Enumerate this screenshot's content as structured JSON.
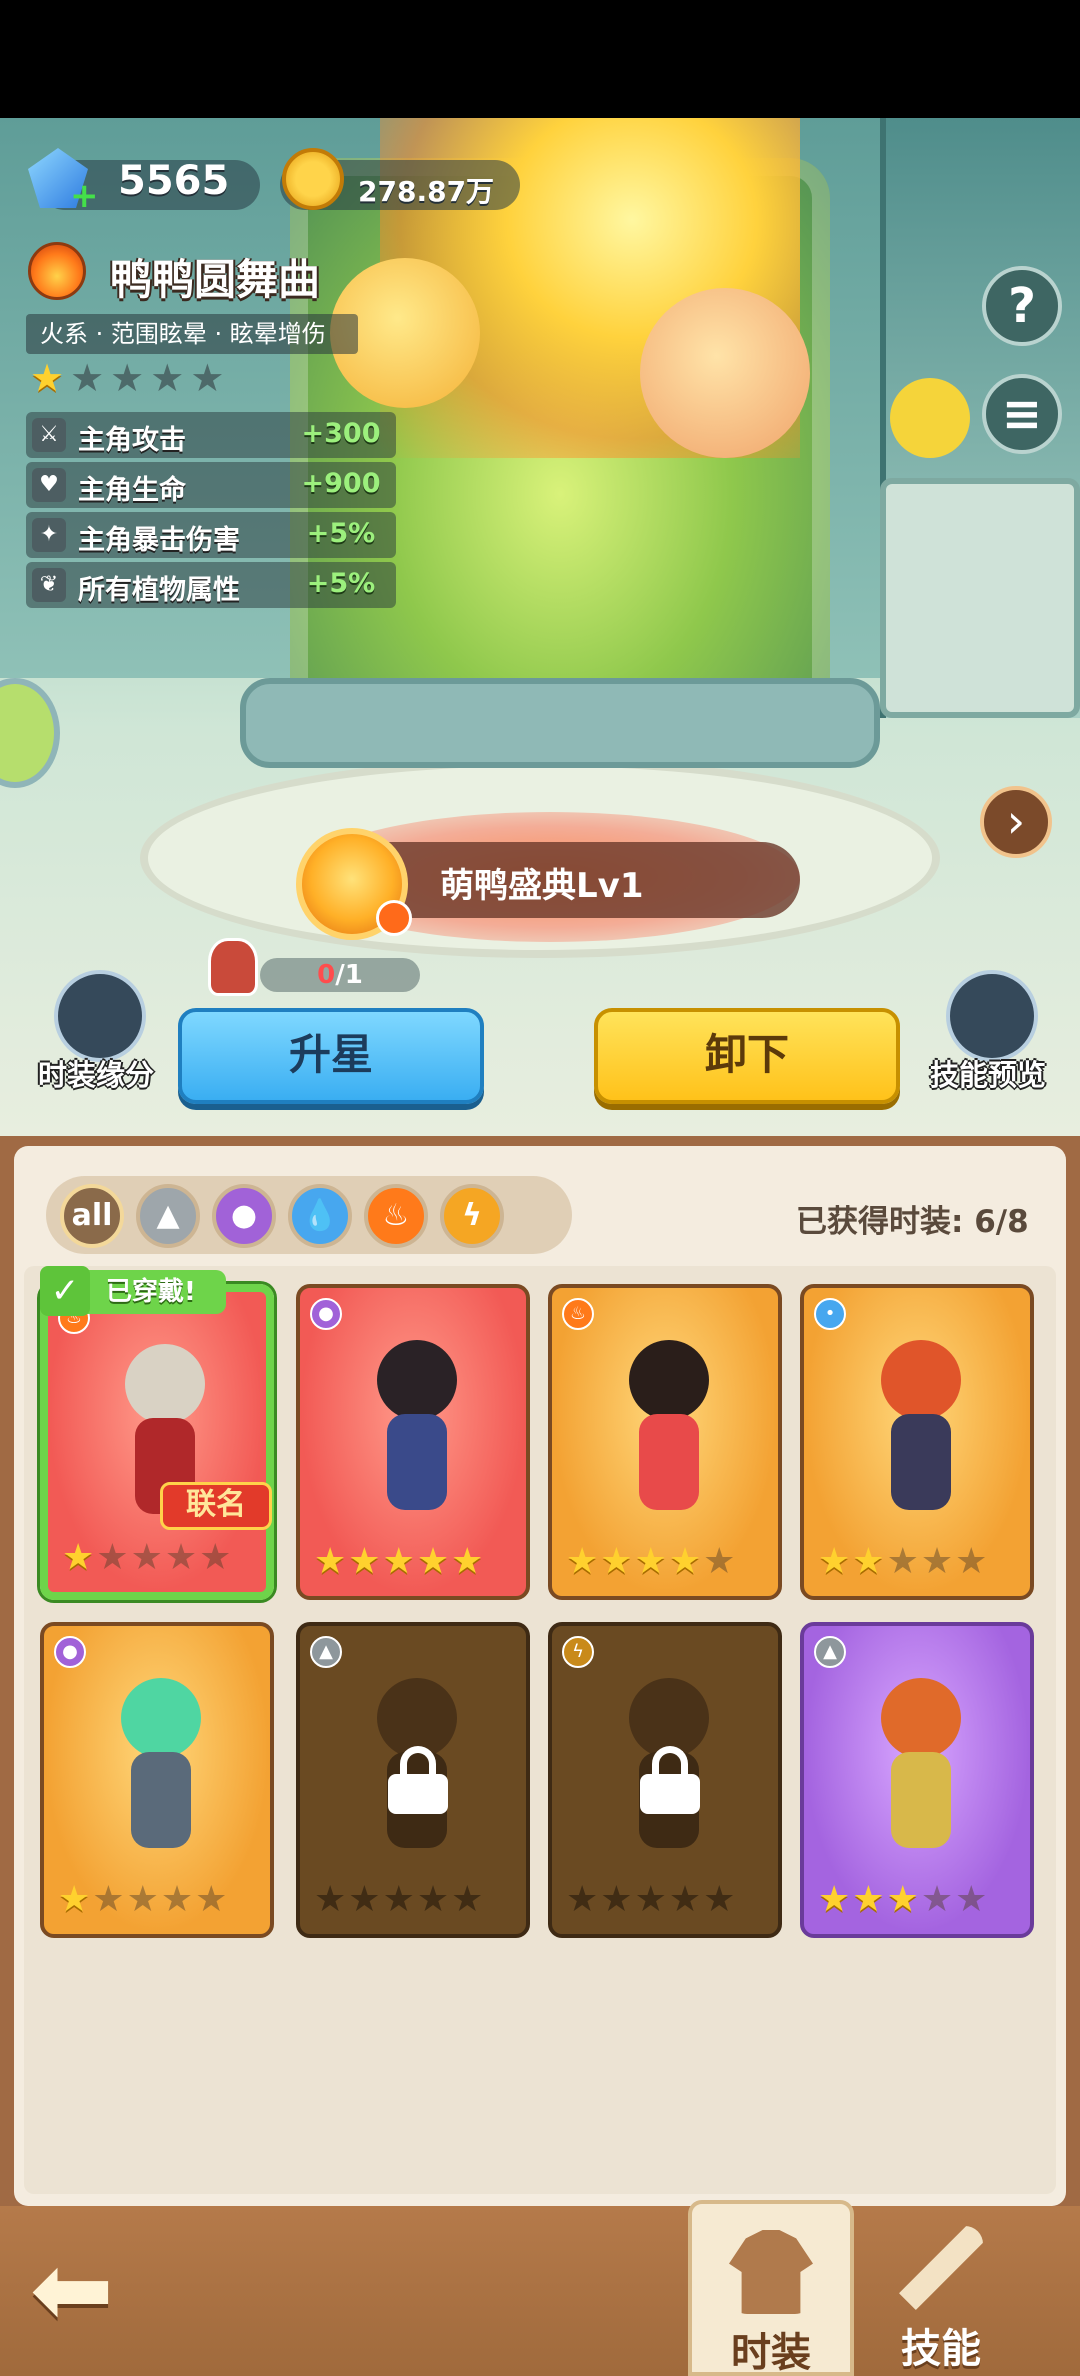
{
  "currency": {
    "gems": "5565",
    "coins": "278.87万"
  },
  "costume": {
    "title": "鸭鸭圆舞曲",
    "tags": "火系 · 范围眩晕 · 眩晕增伤",
    "stars": 1,
    "stars_max": 5,
    "stats": [
      {
        "icon": "sword-icon",
        "label": "主角攻击",
        "value": "+300"
      },
      {
        "icon": "heart-icon",
        "label": "主角生命",
        "value": "+900"
      },
      {
        "icon": "crit-icon",
        "label": "主角暴击伤害",
        "value": "+5%"
      },
      {
        "icon": "plant-icon",
        "label": "所有植物属性",
        "value": "+5%"
      }
    ]
  },
  "right_buttons": {
    "help": "?",
    "list": "≡",
    "next": "›"
  },
  "pet": {
    "name": "萌鸭盛典Lv1"
  },
  "progress": {
    "current": "0",
    "total": "/1"
  },
  "actions": {
    "fashion_bond": "时装缘分",
    "upgrade_star": "升星",
    "unequip": "卸下",
    "skill_preview": "技能预览"
  },
  "filters": {
    "all": "all",
    "items": [
      "all",
      "sword",
      "potion",
      "water",
      "fire",
      "bolt"
    ]
  },
  "owned_text": "已获得时装: 6/8",
  "cards": [
    {
      "color": "red",
      "element": "fire",
      "stars": 1,
      "locked": false,
      "equipped": true,
      "collab": true
    },
    {
      "color": "red",
      "element": "potion",
      "stars": 5,
      "locked": false,
      "equipped": false,
      "collab": false
    },
    {
      "color": "orange",
      "element": "fire",
      "stars": 4,
      "locked": false,
      "equipped": false,
      "collab": false
    },
    {
      "color": "orange",
      "element": "water",
      "stars": 2,
      "locked": false,
      "equipped": false,
      "collab": false
    },
    {
      "color": "orange",
      "element": "potion",
      "stars": 1,
      "locked": false,
      "equipped": false,
      "collab": false
    },
    {
      "color": "locked",
      "element": "sword",
      "stars": 0,
      "locked": true,
      "equipped": false,
      "collab": false
    },
    {
      "color": "locked",
      "element": "bolt",
      "stars": 0,
      "locked": true,
      "equipped": false,
      "collab": false
    },
    {
      "color": "purple",
      "element": "sword",
      "stars": 3,
      "locked": false,
      "equipped": false,
      "collab": false
    }
  ],
  "badges": {
    "equipped": "已穿戴!",
    "collab": "联名"
  },
  "nav": {
    "costume": "时装",
    "skill": "技能"
  }
}
